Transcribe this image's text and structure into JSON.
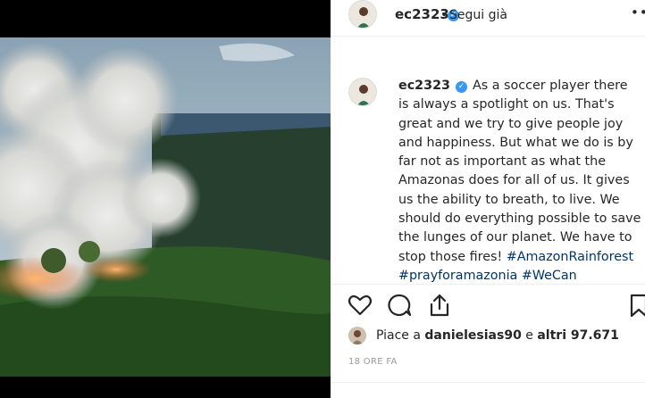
{
  "post": {
    "username": "ec2323",
    "follow_separator": "•",
    "follow_status": "Segui già",
    "more_options": "•••",
    "caption": {
      "username": "ec2323",
      "text": "As a soccer player there is always a spotlight on us. That's great and we try to give people joy and happiness. But what we do is by far not as important as what the Amazonas does for all of us. It gives us the ability to breath, to live. We should do everything possible to save the lunges of our planet. We have to stop those fires!",
      "hashtags": [
        "#AmazonRainforest",
        "#prayforamazonia",
        "#WeCan"
      ]
    },
    "likes": {
      "prefix": "Piace a",
      "user": "danielesias90",
      "connector": "e",
      "others": "altri 97.671"
    },
    "timestamp": "18 ORE FA"
  },
  "icons": {
    "like": "heart-icon",
    "comment": "comment-icon",
    "share": "share-icon",
    "save": "bookmark-icon",
    "verified": "verified-badge-icon"
  },
  "colors": {
    "verified": "#3897f0",
    "hashtag": "#003569",
    "text": "#262626",
    "muted": "#999999"
  }
}
